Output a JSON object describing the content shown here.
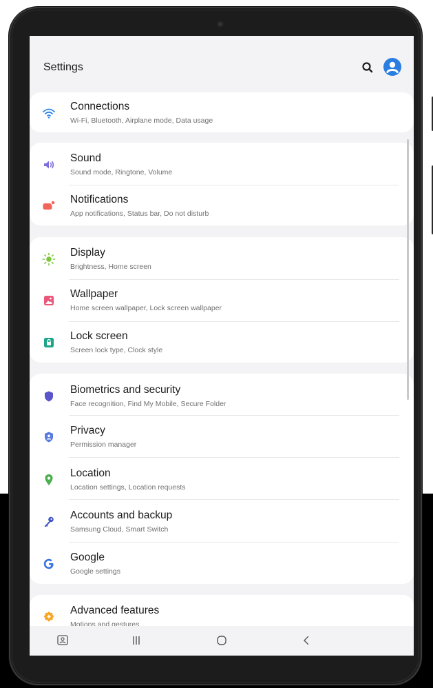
{
  "header": {
    "title": "Settings"
  },
  "groups": [
    {
      "items": [
        {
          "title": "Connections",
          "subtitle": "Wi-Fi, Bluetooth, Airplane mode, Data usage",
          "icon": "wifi-icon",
          "color": "#2a83e6"
        }
      ]
    },
    {
      "items": [
        {
          "title": "Sound",
          "subtitle": "Sound mode, Ringtone, Volume",
          "icon": "volume-icon",
          "color": "#7b6fdc"
        },
        {
          "title": "Notifications",
          "subtitle": "App notifications, Status bar, Do not disturb",
          "icon": "notification-icon",
          "color": "#f2655a"
        }
      ]
    },
    {
      "items": [
        {
          "title": "Display",
          "subtitle": "Brightness, Home screen",
          "icon": "sun-icon",
          "color": "#7cc63a"
        },
        {
          "title": "Wallpaper",
          "subtitle": "Home screen wallpaper, Lock screen wallpaper",
          "icon": "wallpaper-icon",
          "color": "#e9577a"
        },
        {
          "title": "Lock screen",
          "subtitle": "Screen lock type, Clock style",
          "icon": "lock-icon",
          "color": "#1fa48a"
        }
      ]
    },
    {
      "items": [
        {
          "title": "Biometrics and security",
          "subtitle": "Face recognition, Find My Mobile, Secure Folder",
          "icon": "shield-icon",
          "color": "#5a55c9"
        },
        {
          "title": "Privacy",
          "subtitle": "Permission manager",
          "icon": "privacy-shield-icon",
          "color": "#5b7be0"
        },
        {
          "title": "Location",
          "subtitle": "Location settings, Location requests",
          "icon": "location-pin-icon",
          "color": "#4caf50"
        },
        {
          "title": "Accounts and backup",
          "subtitle": "Samsung Cloud, Smart Switch",
          "icon": "key-icon",
          "color": "#3d55c8"
        },
        {
          "title": "Google",
          "subtitle": "Google settings",
          "icon": "google-icon",
          "color": "#3a73e0"
        }
      ]
    },
    {
      "items": [
        {
          "title": "Advanced features",
          "subtitle": "Motions and gestures",
          "icon": "gear-plus-icon",
          "color": "#f5a623"
        }
      ]
    }
  ],
  "navbar": {
    "buttons": [
      {
        "name": "screenshot-nav-icon"
      },
      {
        "name": "recent-apps-icon"
      },
      {
        "name": "home-icon"
      },
      {
        "name": "back-icon"
      }
    ]
  }
}
